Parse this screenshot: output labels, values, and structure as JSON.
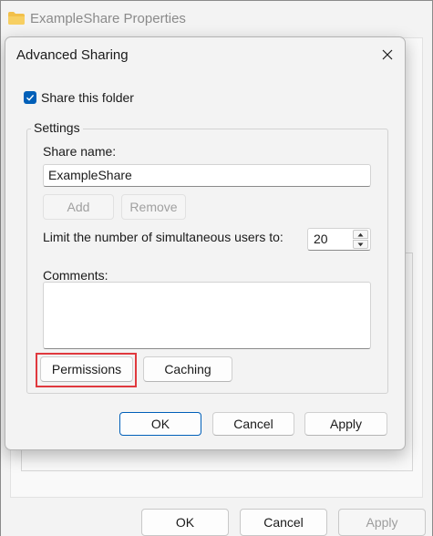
{
  "background_window": {
    "title": "ExampleShare Properties",
    "buttons": {
      "ok": "OK",
      "cancel": "Cancel",
      "apply": "Apply"
    }
  },
  "dialog": {
    "title": "Advanced Sharing",
    "share_checkbox": {
      "label": "Share this folder",
      "checked": true
    },
    "settings": {
      "legend": "Settings",
      "share_name_label": "Share name:",
      "share_name_value": "ExampleShare",
      "add_label": "Add",
      "remove_label": "Remove",
      "limit_label": "Limit the number of simultaneous users to:",
      "limit_value": "20",
      "comments_label": "Comments:",
      "comments_value": "",
      "permissions_label": "Permissions",
      "caching_label": "Caching"
    },
    "buttons": {
      "ok": "OK",
      "cancel": "Cancel",
      "apply": "Apply"
    }
  },
  "colors": {
    "accent": "#005fb8",
    "highlight": "#e0393e",
    "folder": "#f2c04a"
  },
  "icons": [
    "folder-icon",
    "close-icon",
    "checkmark-icon",
    "spin-up-icon",
    "spin-down-icon"
  ]
}
